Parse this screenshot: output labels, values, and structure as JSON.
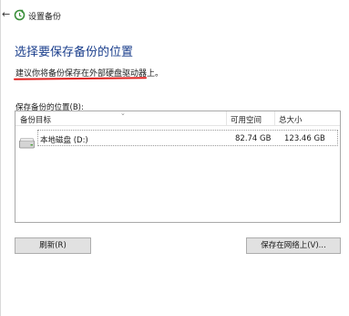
{
  "window": {
    "title": "设置备份"
  },
  "main": {
    "heading": "选择要保存备份的位置",
    "hint": "建议你将备份保存在外部硬盘驱动器上。",
    "list_label": "保存备份的位置(B):"
  },
  "table": {
    "columns": [
      "备份目标",
      "可用空间",
      "总大小"
    ],
    "rows": [
      {
        "name": "本地磁盘 (D:)",
        "free": "82.74 GB",
        "total": "123.46 GB"
      }
    ]
  },
  "buttons": {
    "refresh": "刷新(R)",
    "save_network": "保存在网络上(V)..."
  },
  "colors": {
    "heading": "#1a3e8c",
    "underline": "#e0201e"
  }
}
